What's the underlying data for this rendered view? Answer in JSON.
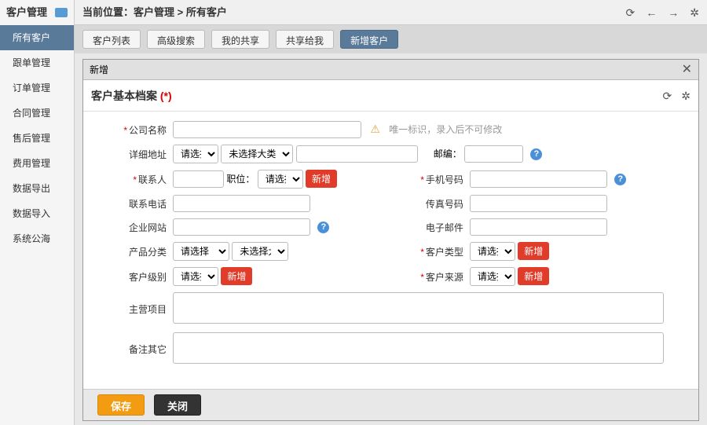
{
  "sidebar": {
    "title": "客户管理",
    "items": [
      {
        "label": "所有客户",
        "active": true
      },
      {
        "label": "跟单管理"
      },
      {
        "label": "订单管理"
      },
      {
        "label": "合同管理"
      },
      {
        "label": "售后管理"
      },
      {
        "label": "费用管理"
      },
      {
        "label": "数据导出"
      },
      {
        "label": "数据导入"
      },
      {
        "label": "系统公海"
      }
    ]
  },
  "breadcrumb": "当前位置：客户管理 > 所有客户",
  "tabs": [
    {
      "label": "客户列表"
    },
    {
      "label": "高级搜索"
    },
    {
      "label": "我的共享"
    },
    {
      "label": "共享给我"
    },
    {
      "label": "新增客户",
      "active": true
    }
  ],
  "modal": {
    "title": "新增",
    "card_title": "客户基本档案",
    "card_required_marker": "(*)",
    "footer": {
      "save": "保存",
      "close": "关闭"
    }
  },
  "form": {
    "company_name": {
      "label": "公司名称",
      "hint": "唯一标识，录入后不可修改"
    },
    "address": {
      "label": "详细地址",
      "select_placeholder": "请选择",
      "big_cat_placeholder": "未选择大类",
      "postal_label": "邮编："
    },
    "contact": {
      "label": "联系人",
      "position_label": "职位：",
      "position_placeholder": "请选择",
      "add_btn": "新增"
    },
    "mobile": {
      "label": "手机号码"
    },
    "phone": {
      "label": "联系电话"
    },
    "fax": {
      "label": "传真号码"
    },
    "website": {
      "label": "企业网站"
    },
    "email": {
      "label": "电子邮件"
    },
    "product_cat": {
      "label": "产品分类",
      "select_placeholder": "请选择",
      "big_cat_placeholder": "未选择大类"
    },
    "customer_type": {
      "label": "客户类型",
      "select_placeholder": "请选择",
      "add_btn": "新增"
    },
    "customer_level": {
      "label": "客户级别",
      "select_placeholder": "请选择",
      "add_btn": "新增"
    },
    "customer_source": {
      "label": "客户来源",
      "select_placeholder": "请选择",
      "add_btn": "新增"
    },
    "main_business": {
      "label": "主营项目"
    },
    "remarks": {
      "label": "备注其它"
    }
  }
}
